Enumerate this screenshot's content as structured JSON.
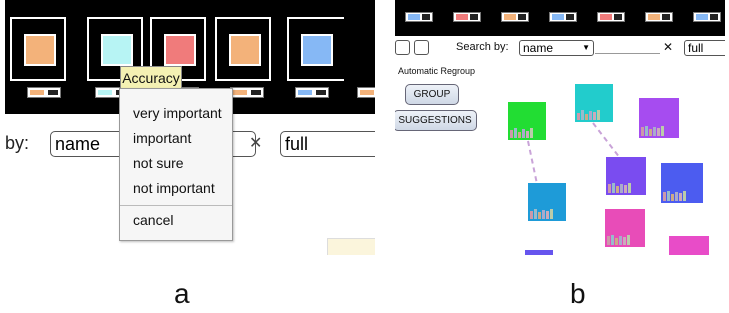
{
  "panel_a": {
    "tooltip": "Accuracy",
    "menu_items": [
      "very important",
      "important",
      "not sure",
      "not important"
    ],
    "cancel_label": "cancel",
    "search_label": "by:",
    "search_value": "name",
    "filter_value": "full",
    "close_icon": "✕",
    "colors": {
      "tile1": "#f3b27a",
      "tile2": "#b7f4f4",
      "tile3": "#f07b7b",
      "tile4": "#f3b27a",
      "tile5": "#86b8f5"
    }
  },
  "panel_b": {
    "search_label": "Search by:",
    "search_value": "name",
    "dropdown_arrow": "▼",
    "close_icon": "✕",
    "filter_value": "full",
    "auto_regroup_label": "Automatic Regroup",
    "group_button": "GROUP",
    "suggestions_button": "SUGGESTIONS",
    "node_colors": [
      "#22dd33",
      "#22cccc",
      "#a64cf0",
      "#7a4cf0",
      "#4c5cf0",
      "#1e9bd8",
      "#e84cb8",
      "#e84cc8",
      "#6655ee"
    ]
  },
  "captions": {
    "a": "a",
    "b": "b"
  }
}
